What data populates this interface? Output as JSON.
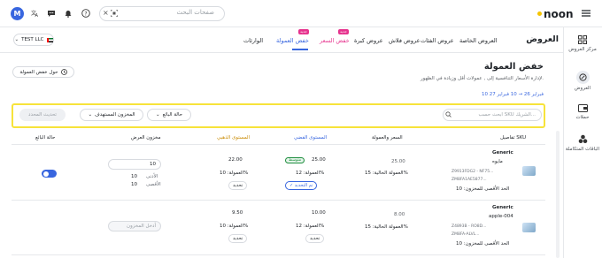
{
  "header": {
    "brand": "noon",
    "search_placeholder": "صفحات البحث",
    "avatar_initial": "M"
  },
  "sidebar": {
    "items": [
      {
        "label": "مركز العروض",
        "icon": "grid-icon"
      },
      {
        "label": "العروض",
        "icon": "tag-icon"
      },
      {
        "label": "حملات",
        "icon": "wallet-icon"
      },
      {
        "label": "الباقات المتكاملة",
        "icon": "bundle-icon"
      }
    ]
  },
  "nav": {
    "heading": "العروض",
    "tabs": [
      "العروض الخاصة",
      "عروض الفئات",
      "عروض فلاش",
      "عروض كبرة",
      "خفض السعر",
      "خفض العمولة",
      "الوارئات"
    ],
    "new_badge": "جديد",
    "store": "TEST LLC"
  },
  "page": {
    "title": "خفض العمولة",
    "subtitle": "لإدارة الأسعار التنافسية إلى , عمولات أقل وزيادة في الظهور.",
    "history_button": "حول خفض العمولة",
    "date_range": "10 فبراير 26 → 10 فبراير 27"
  },
  "filters": {
    "search_placeholder": "ابحث حسب SKU الشريك...",
    "seller_state": "حالة البائع",
    "target_stock": "المخزون المستهدف",
    "update_button": "تحديث المحدد"
  },
  "table": {
    "headers": [
      "تفاصيل SKU",
      "السعر والعمولة",
      "المستوى الفضي",
      "المستوى الذهبي",
      "مخزون العرض",
      "حالة البائع"
    ],
    "rows": [
      {
        "name": "Generic",
        "sub": "مايوه",
        "code1": "Z9913FDG2 - NF75...",
        "code2": "ZM8FA1AE5877...",
        "min_stock": "الحد الأقصى للمخزون: 10",
        "price": "25.00",
        "commission": "العمولة الحالية: 15%",
        "silver_price": "25.00",
        "silver_badge": "متوسط",
        "silver_commission": "العمولة: 12%",
        "silver_action": "تم التحديد",
        "gold_price": "22.00",
        "gold_commission": "العمولة: 10%",
        "gold_action": "تحديد",
        "stock": "10",
        "stock_min_label": "10",
        "stock_max_label": "10",
        "stock_min_text": "الأدنى",
        "stock_max_text": "الأقصى"
      },
      {
        "name": "Generic",
        "sub": "apple-004",
        "code1": "Z4893B - RO8D...",
        "code2": "ZM8FA-ALVL...",
        "min_stock": "الحد الأقصى للمخزون: 10",
        "price": "8.00",
        "commission": "العمولة الحالية: 15%",
        "silver_price": "10.00",
        "silver_commission": "العمولة: 12%",
        "silver_action": "تحديد",
        "gold_price": "9.50",
        "gold_commission": "العمولة: 10%",
        "gold_action": "تحديد",
        "stock_placeholder": "أدخل المخزون"
      }
    ]
  }
}
